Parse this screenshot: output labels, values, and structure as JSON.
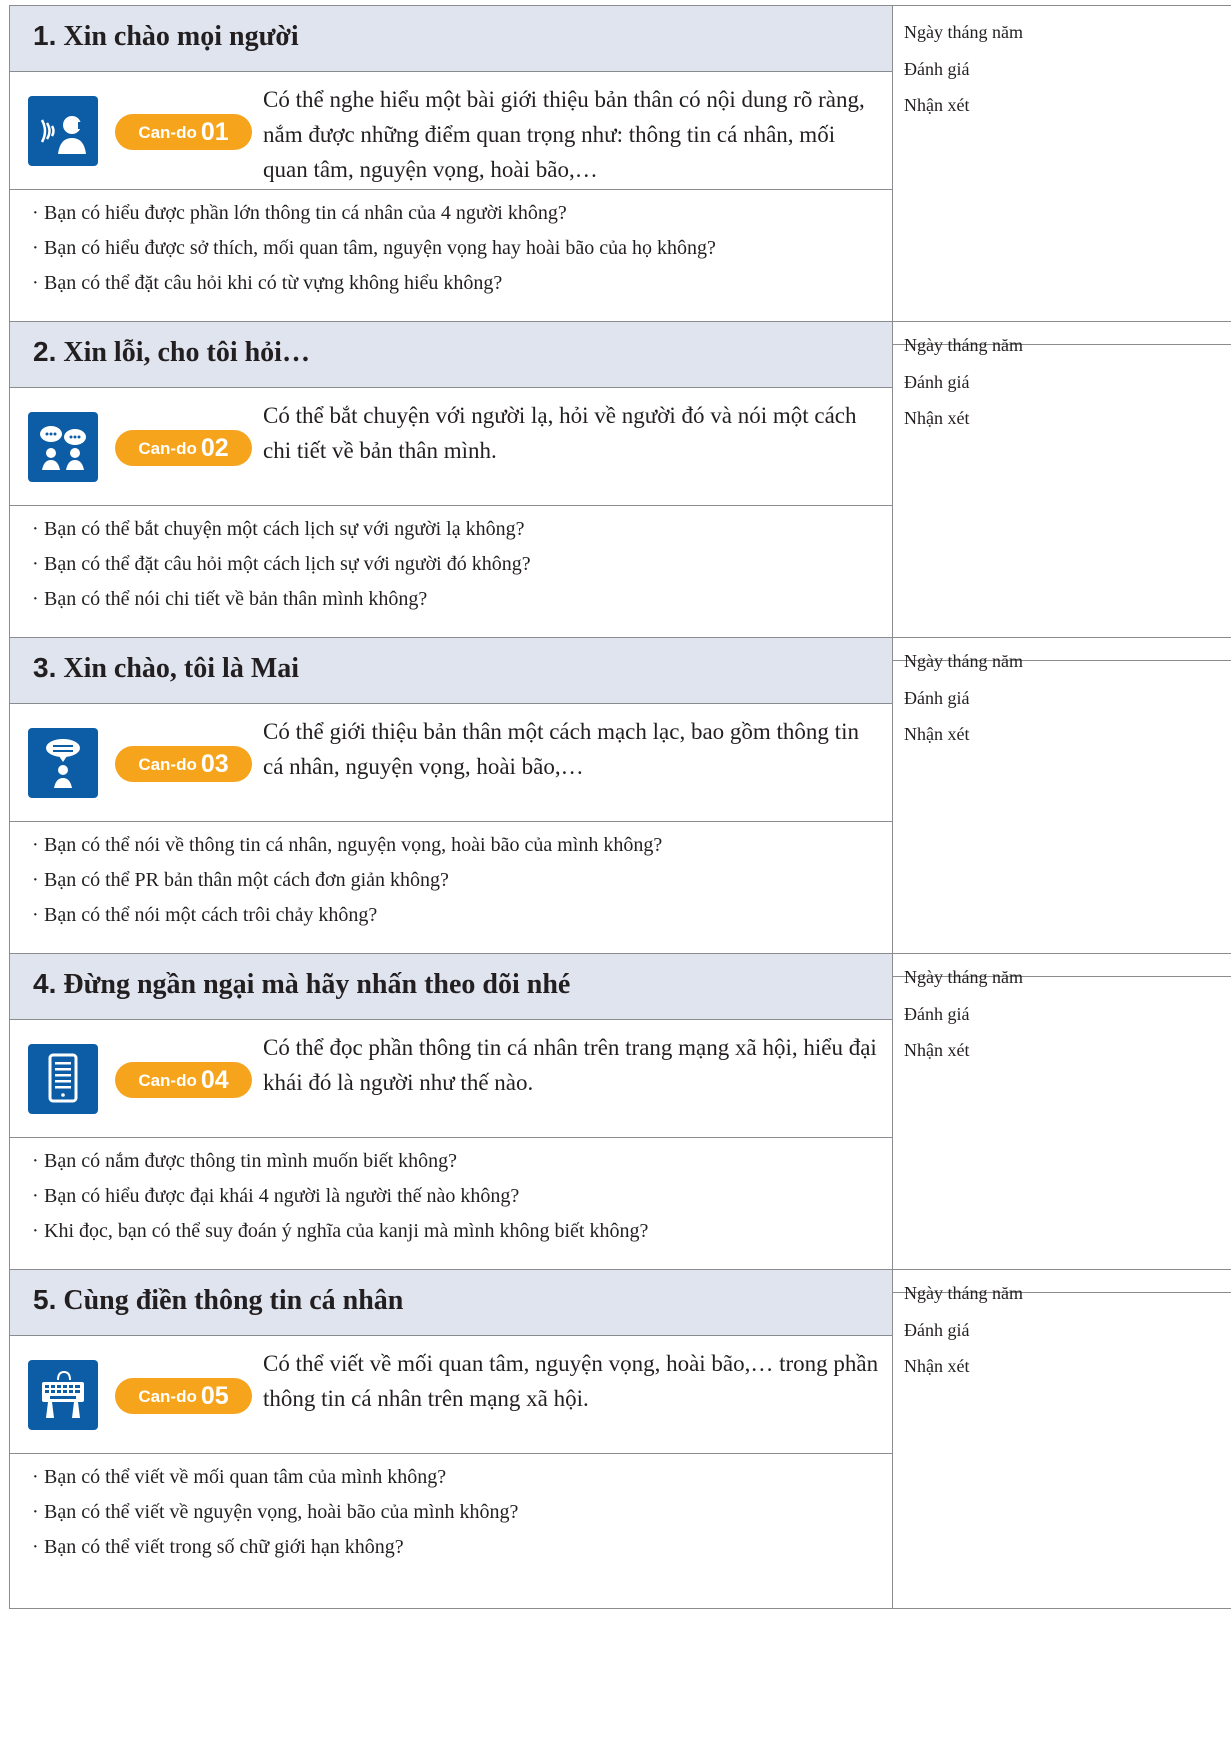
{
  "right_labels": {
    "date": "Ngày  tháng  năm",
    "rating": "Đánh giá",
    "comment": "Nhận xét"
  },
  "sections": [
    {
      "number": "1.",
      "title": "Xin chào mọi người",
      "cando_label": "Can-do",
      "cando_number": "01",
      "icon": "listening-person-icon",
      "description": "Có thể nghe hiểu một bài giới thiệu bản thân có nội dung rõ ràng, nắm được những điểm quan trọng như: thông tin cá nhân, mối quan tâm, nguyện vọng, hoài bão,…",
      "checks": [
        "Bạn có hiểu được phần lớn thông tin cá nhân của 4 người không?",
        "Bạn có hiểu được sở thích, mối quan tâm, nguyện vọng hay hoài bão của họ không?",
        "Bạn có thể đặt câu hỏi khi có từ vựng không hiểu không?"
      ]
    },
    {
      "number": "2.",
      "title": "Xin lỗi, cho tôi hỏi…",
      "cando_label": "Can-do",
      "cando_number": "02",
      "icon": "conversation-icon",
      "description": "Có thể bắt chuyện với người lạ, hỏi về người đó và nói một cách chi tiết về bản thân mình.",
      "checks": [
        "Bạn có thể bắt chuyện một cách lịch sự với người lạ không?",
        "Bạn có thể đặt câu hỏi một cách lịch sự với người đó không?",
        "Bạn có thể nói chi tiết về bản thân mình không?"
      ]
    },
    {
      "number": "3.",
      "title": "Xin chào, tôi là Mai",
      "cando_label": "Can-do",
      "cando_number": "03",
      "icon": "speaking-person-icon",
      "description": "Có thể giới thiệu bản thân một cách mạch lạc, bao gồm thông tin cá nhân, nguyện vọng, hoài bão,…",
      "checks": [
        "Bạn có thể nói về thông tin cá nhân, nguyện vọng, hoài bão của mình không?",
        "Bạn có thể PR bản thân một cách đơn giản không?",
        "Bạn có thể nói một cách trôi chảy không?"
      ]
    },
    {
      "number": "4.",
      "title": "Đừng ngần ngại mà hãy nhấn theo dõi nhé",
      "cando_label": "Can-do",
      "cando_number": "04",
      "icon": "tablet-reading-icon",
      "description": "Có thể đọc phần thông tin cá nhân trên trang mạng xã hội, hiểu đại khái đó là người như thế nào.",
      "checks": [
        "Bạn có nắm được thông tin mình muốn biết không?",
        "Bạn có hiểu được đại khái 4 người là người thế nào không?",
        "Khi đọc, bạn có thể suy đoán ý nghĩa của kanji mà mình không biết không?"
      ]
    },
    {
      "number": "5.",
      "title": "Cùng điền thông tin cá nhân",
      "cando_label": "Can-do",
      "cando_number": "05",
      "icon": "keyboard-typing-icon",
      "description": "Có thể viết về mối quan tâm, nguyện vọng, hoài bão,… trong phần thông tin cá nhân trên mạng xã hội.",
      "checks": [
        "Bạn có thể viết về mối quan tâm của mình không?",
        "Bạn có thể viết về nguyện vọng, hoài bão của mình không?",
        "Bạn có thể viết trong số chữ giới hạn không?"
      ]
    }
  ]
}
